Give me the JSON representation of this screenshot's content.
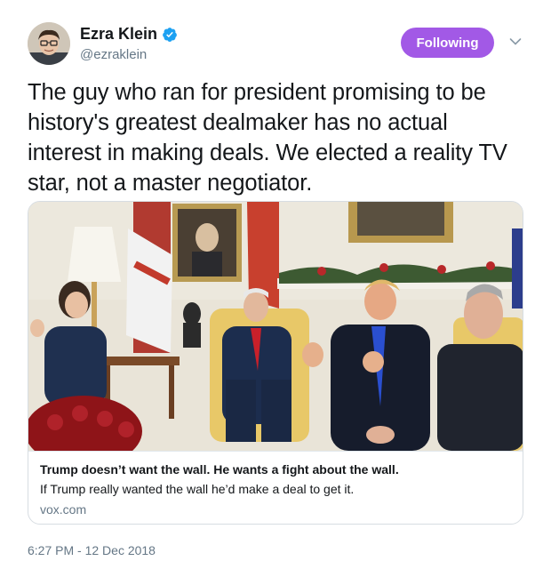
{
  "author": {
    "display_name": "Ezra Klein",
    "handle": "@ezraklein",
    "verified_color": "#1da1f2"
  },
  "follow_button": {
    "label": "Following",
    "color": "#a259e6"
  },
  "menu_icon": "chevron-down-icon",
  "tweet": {
    "text": "The guy who ran for president promising to be history's greatest dealmaker has no actual interest in making deals. We elected a reality TV star, not a master negotiator."
  },
  "card": {
    "image_description_icon": "photo",
    "title": "Trump doesn’t want the wall. He wants a fight about the wall.",
    "description": "If Trump really wanted the wall he’d make a deal to get it.",
    "domain": "vox.com"
  },
  "timestamp": "6:27 PM - 12 Dec 2018"
}
